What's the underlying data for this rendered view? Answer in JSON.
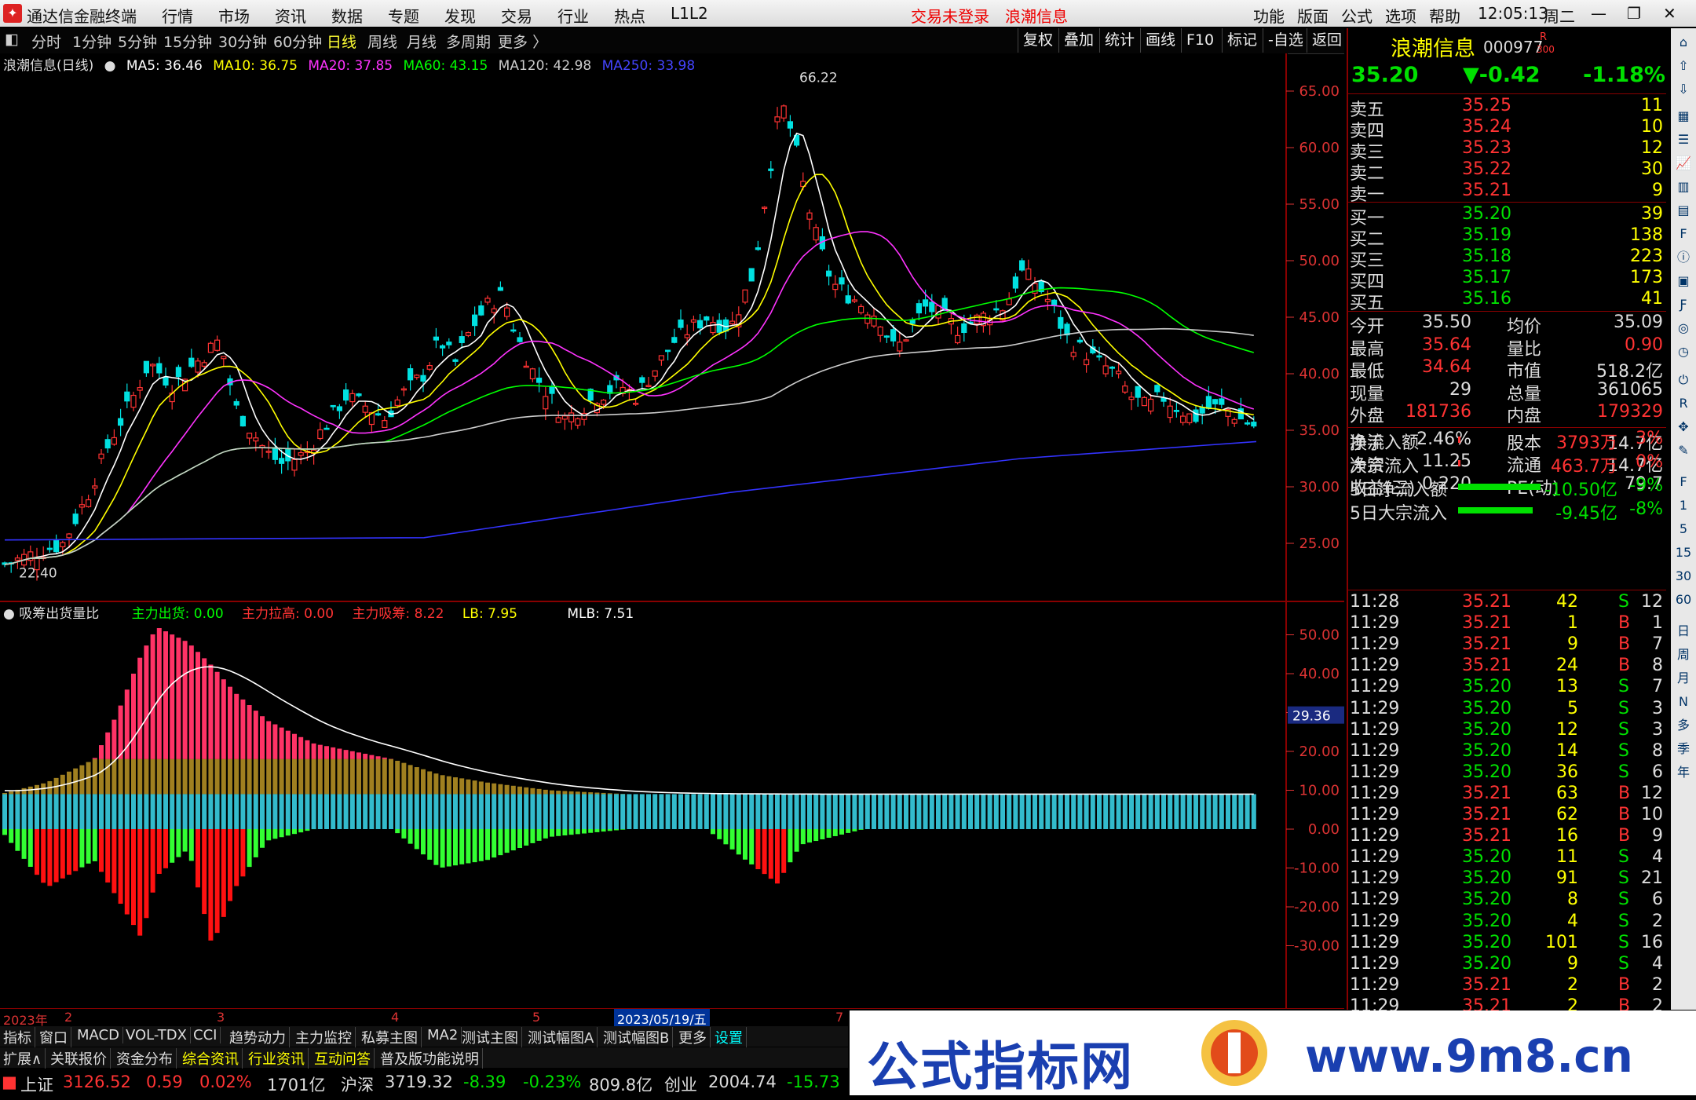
{
  "titlebar": {
    "app_title": "通达信金融终端",
    "menus": [
      "行情",
      "市场",
      "资讯",
      "数据",
      "专题",
      "发现",
      "交易",
      "行业",
      "热点",
      "L1L2"
    ],
    "login_status": "交易未登录",
    "stock_name": "浪潮信息",
    "right_menus": [
      "功能",
      "版面",
      "公式",
      "选项",
      "帮助"
    ],
    "clock": "12:05:13",
    "weekday": "周二"
  },
  "timeframes": [
    "分时",
    "1分钟",
    "5分钟",
    "15分钟",
    "30分钟",
    "60分钟",
    "日线",
    "周线",
    "月线",
    "多周期",
    "更多"
  ],
  "active_timeframe": "日线",
  "toolbar_buttons": [
    "复权",
    "叠加",
    "统计",
    "画线",
    "F10",
    "标记",
    "-自选",
    "返回"
  ],
  "main_legend": {
    "title": "浪潮信息(日线)",
    "items": [
      {
        "label": "MA5: 36.46",
        "color": "#ffffff"
      },
      {
        "label": "MA10: 36.75",
        "color": "#ffff00"
      },
      {
        "label": "MA20: 37.85",
        "color": "#ff33ff"
      },
      {
        "label": "MA60: 43.15",
        "color": "#00ff00"
      },
      {
        "label": "MA120: 42.98",
        "color": "#cccccc"
      },
      {
        "label": "MA250: 33.98",
        "color": "#3333ff"
      }
    ]
  },
  "price_axis": [
    "65.00",
    "60.00",
    "55.00",
    "50.00",
    "45.00",
    "40.00",
    "35.00",
    "30.00",
    "25.00"
  ],
  "annotations": {
    "high": "66.22",
    "low": "22.40"
  },
  "sub_legend": {
    "title": "吸筹出货量比",
    "items": [
      {
        "label": "主力出货: 0.00",
        "color": "#00ff00"
      },
      {
        "label": "主力拉高: 0.00",
        "color": "#ff3333"
      },
      {
        "label": "主力吸筹: 8.22",
        "color": "#ff3333"
      },
      {
        "label": "LB: 7.95",
        "color": "#ffff00"
      },
      {
        "label": "MLB: 7.51",
        "color": "#ffffff"
      }
    ]
  },
  "sub_axis": [
    "50.00",
    "40.00",
    "30.00",
    "20.00",
    "10.00",
    "0.00",
    "-10.00",
    "-20.00",
    "-30.00"
  ],
  "sub_marker": "29.36",
  "date_axis": [
    "2023年",
    "2",
    "3",
    "4",
    "5",
    "2023/05/19/五",
    "7"
  ],
  "tabs_row1": [
    "指标",
    "窗口",
    "MACD",
    "VOL-TDX",
    "CCI",
    "趋势动力",
    "主力监控",
    "私募主图",
    "MA2",
    "测试主图",
    "测试幅图A",
    "测试幅图B",
    "更多",
    "设置"
  ],
  "tabs_row2": [
    "扩展∧",
    "关联报价",
    "资金分布",
    "综合资讯",
    "行业资讯",
    "互动问答",
    "普及版功能说明"
  ],
  "status": {
    "sh_label": "上证",
    "sh_val": "3126.52",
    "sh_chg": "0.59",
    "sh_pct": "0.02%",
    "sh_amt": "1701亿",
    "hs_label": "沪深",
    "hs_val": "3719.32",
    "hs_chg": "-8.39",
    "hs_pct": "-0.23%",
    "hs_amt": "809.8亿",
    "cy_label": "创业",
    "cy_val": "2004.74",
    "cy_chg": "-15.73"
  },
  "quote": {
    "name": "浪潮信息",
    "code": "000977",
    "badge": "R",
    "badge2": "300",
    "price": "35.20",
    "change": "▼-0.42",
    "pct": "-1.18%",
    "asks": [
      [
        "卖五",
        "35.25",
        "11"
      ],
      [
        "卖四",
        "35.24",
        "10"
      ],
      [
        "卖三",
        "35.23",
        "12"
      ],
      [
        "卖二",
        "35.22",
        "30"
      ],
      [
        "卖一",
        "35.21",
        "9"
      ]
    ],
    "bids": [
      [
        "买一",
        "35.20",
        "39"
      ],
      [
        "买二",
        "35.19",
        "138"
      ],
      [
        "买三",
        "35.18",
        "223"
      ],
      [
        "买四",
        "35.17",
        "173"
      ],
      [
        "买五",
        "35.16",
        "41"
      ]
    ],
    "stats": [
      [
        "今开",
        "35.50",
        "均价",
        "35.09"
      ],
      [
        "最高",
        "35.64",
        "量比",
        "0.90"
      ],
      [
        "最低",
        "34.64",
        "市值",
        "518.2亿"
      ],
      [
        "现量",
        "29",
        "总量",
        "361065"
      ],
      [
        "外盘",
        "181736",
        "内盘",
        "179329"
      ],
      [
        "换手",
        "2.46%",
        "股本",
        "14.7亿"
      ],
      [
        "净资",
        "11.25",
        "流通",
        "14.7亿"
      ],
      [
        "收益(三)",
        "0.220",
        "PE(动)",
        "79.7"
      ]
    ],
    "flows": [
      {
        "label": "净流入额",
        "val": "3793万",
        "pct": "3%",
        "bar": 0.01,
        "color": "#ff3333"
      },
      {
        "label": "大宗流入",
        "val": "463.7万",
        "pct": "0%",
        "bar": 0.005,
        "color": "#ff3333"
      },
      {
        "label": "5日净流入额",
        "val": "-10.50亿",
        "pct": "-9%",
        "bar": 0.75,
        "color": "#00e000"
      },
      {
        "label": "5日大宗流入",
        "val": "-9.45亿",
        "pct": "-8%",
        "bar": 0.68,
        "color": "#00e000"
      }
    ],
    "ticks": [
      [
        "11:28",
        "35.21",
        "42",
        "S",
        "12"
      ],
      [
        "11:29",
        "35.21",
        "1",
        "B",
        "1"
      ],
      [
        "11:29",
        "35.21",
        "9",
        "B",
        "7"
      ],
      [
        "11:29",
        "35.21",
        "24",
        "B",
        "8"
      ],
      [
        "11:29",
        "35.20",
        "13",
        "S",
        "7"
      ],
      [
        "11:29",
        "35.20",
        "5",
        "S",
        "3"
      ],
      [
        "11:29",
        "35.20",
        "12",
        "S",
        "3"
      ],
      [
        "11:29",
        "35.20",
        "14",
        "S",
        "8"
      ],
      [
        "11:29",
        "35.20",
        "36",
        "S",
        "6"
      ],
      [
        "11:29",
        "35.21",
        "63",
        "B",
        "12"
      ],
      [
        "11:29",
        "35.21",
        "62",
        "B",
        "10"
      ],
      [
        "11:29",
        "35.21",
        "16",
        "B",
        "9"
      ],
      [
        "11:29",
        "35.20",
        "11",
        "S",
        "4"
      ],
      [
        "11:29",
        "35.20",
        "91",
        "S",
        "21"
      ],
      [
        "11:29",
        "35.20",
        "8",
        "S",
        "6"
      ],
      [
        "11:29",
        "35.20",
        "4",
        "S",
        "2"
      ],
      [
        "11:29",
        "35.20",
        "101",
        "S",
        "16"
      ],
      [
        "11:29",
        "35.20",
        "9",
        "S",
        "4"
      ],
      [
        "11:29",
        "35.21",
        "2",
        "B",
        "2"
      ],
      [
        "11:29",
        "35.21",
        "2",
        "B",
        "2"
      ]
    ]
  },
  "side_tools": [
    "日",
    "周",
    "月",
    "N",
    "多",
    "季",
    "年"
  ],
  "banner": {
    "left": "公式指标网",
    "right": "www.9m8.cn"
  }
}
